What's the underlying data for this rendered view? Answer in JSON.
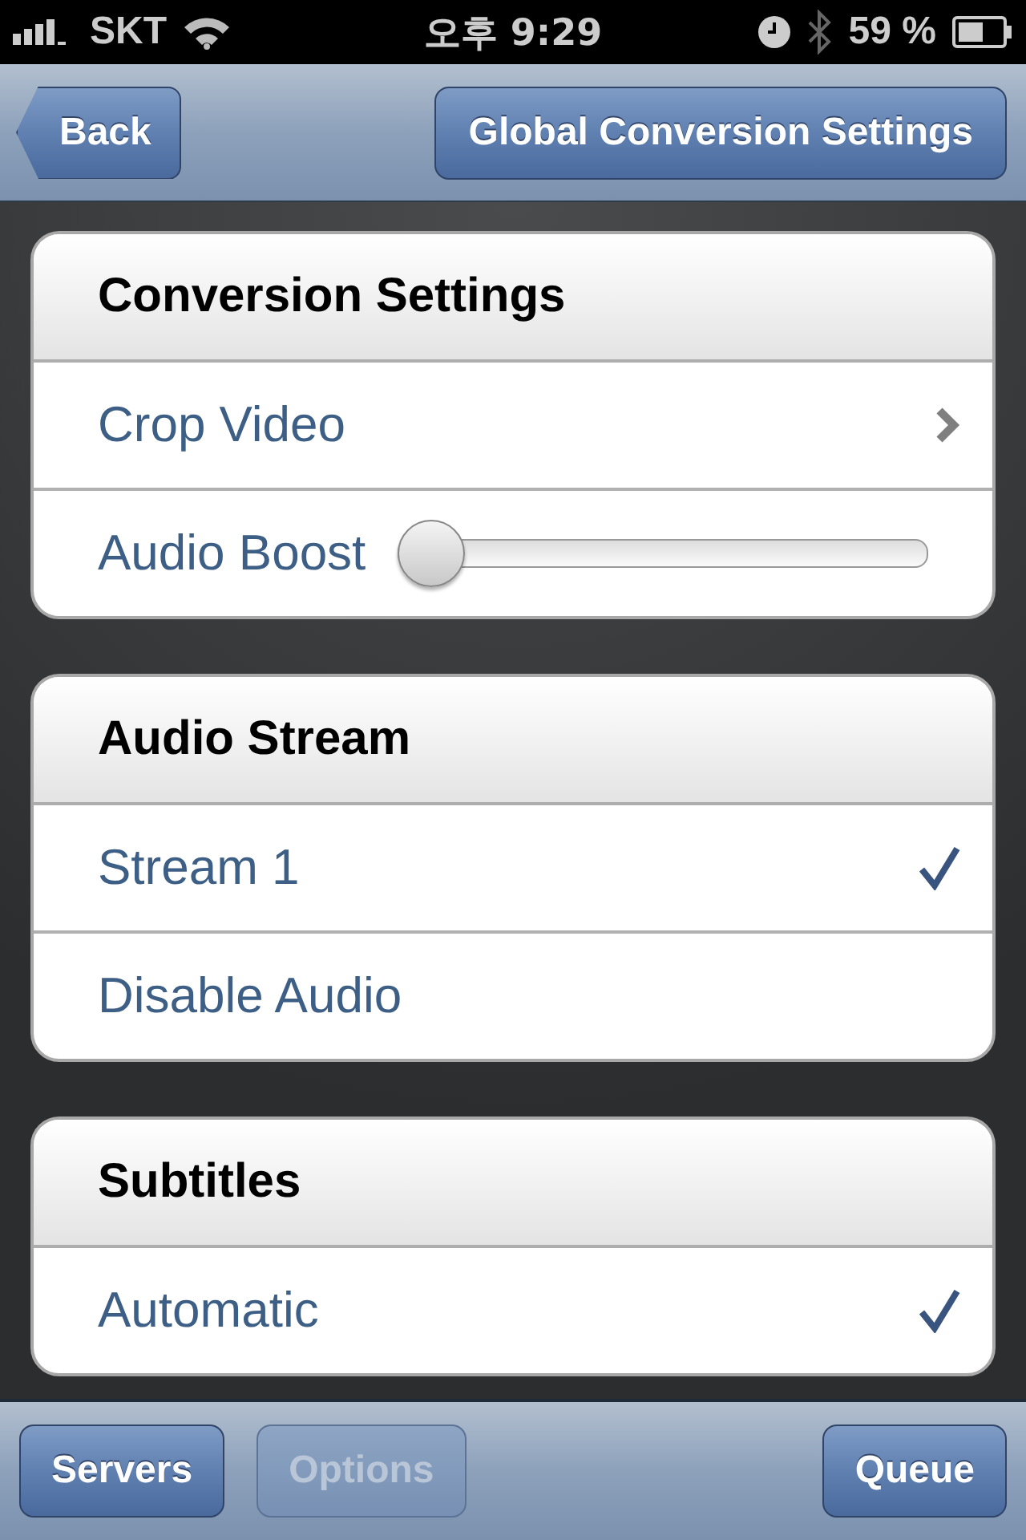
{
  "status_bar": {
    "carrier": "SKT",
    "time": "오후 9:29",
    "battery": "59 %"
  },
  "nav_bar": {
    "back": "Back",
    "action": "Global Conversion Settings"
  },
  "sections": [
    {
      "title": "Conversion Settings",
      "rows": [
        {
          "kind": "link",
          "label": "Crop Video"
        },
        {
          "kind": "slider",
          "label": "Audio Boost",
          "level": 0
        }
      ]
    },
    {
      "title": "Audio Stream",
      "rows": [
        {
          "kind": "check",
          "label": "Stream 1",
          "selected": true
        },
        {
          "kind": "check",
          "label": "Disable Audio",
          "selected": false
        }
      ]
    },
    {
      "title": "Subtitles",
      "rows": [
        {
          "kind": "check",
          "label": "Automatic",
          "selected": true
        }
      ]
    }
  ],
  "toolbar": [
    {
      "label": "Servers",
      "disabled": false
    },
    {
      "label": "Options",
      "disabled": true
    },
    {
      "label": "Queue",
      "disabled": false
    }
  ]
}
